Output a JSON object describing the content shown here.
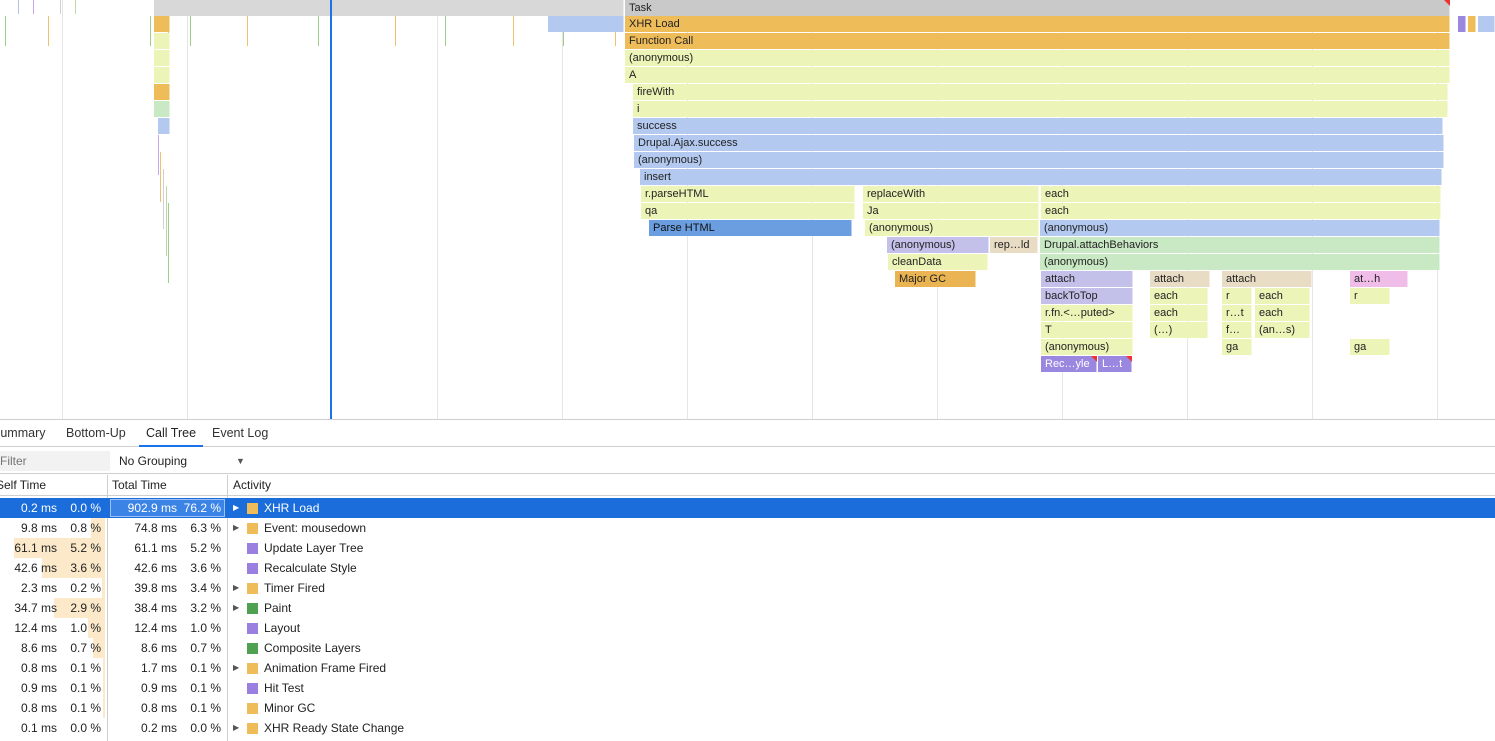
{
  "flame": {
    "labels": {
      "task": "Task",
      "xhr_load": "XHR Load",
      "function_call": "Function Call",
      "anonymous1": "(anonymous)",
      "a": "A",
      "fire_with": "fireWith",
      "i": "i",
      "success": "success",
      "drupal_ajax_success": "Drupal.Ajax.success",
      "anonymous2": "(anonymous)",
      "insert": "insert",
      "r_parse_html": "r.parseHTML",
      "qa": "qa",
      "parse_html": "Parse HTML",
      "replace_with": "replaceWith",
      "ja": "Ja",
      "anonymous3": "(anonymous)",
      "anonymous4": "(anonymous)",
      "rep_ld": "rep…ld",
      "clean_data": "cleanData",
      "major_gc": "Major GC",
      "each1": "each",
      "each2": "each",
      "anonymous5": "(anonymous)",
      "drupal_attach_behaviors": "Drupal.attachBehaviors",
      "anonymous6": "(anonymous)",
      "attach1": "attach",
      "attach2": "attach",
      "attach3": "attach",
      "at_h": "at…h",
      "back_to_top": "backToTop",
      "each3": "each",
      "r1": "r",
      "each4": "each",
      "r2": "r",
      "rfn_computed": "r.fn.<…puted>",
      "each5": "each",
      "r_t": "r…t",
      "each6": "each",
      "t": "T",
      "paren": "(…)",
      "f_dots": "f…",
      "an_s": "(an…s)",
      "anonymous7": "(anonymous)",
      "ga1": "ga",
      "ga2": "ga",
      "rec_yle": "Rec…yle",
      "l_t": "L…t"
    }
  },
  "tabs": {
    "summary": "Summary",
    "bottom_up": "Bottom-Up",
    "call_tree": "Call Tree",
    "event_log": "Event Log"
  },
  "toolbar": {
    "filter_placeholder": "Filter",
    "grouping_value": "No Grouping"
  },
  "columns": {
    "self_time": "Self Time",
    "total_time": "Total Time",
    "activity": "Activity"
  },
  "colors": {
    "scripting": "#efbc5a",
    "rendering": "#9a7fe0",
    "painting": "#4fa14f",
    "selection": "#1a6ddb"
  },
  "rows": [
    {
      "self_ms": "0.2 ms",
      "self_pct": "0.0 %",
      "self_frac": 0.0,
      "total_ms": "902.9 ms",
      "total_pct": "76.2 %",
      "total_frac": 0.762,
      "activity": "XHR Load",
      "category": "scripting",
      "expandable": true,
      "selected": true
    },
    {
      "self_ms": "9.8 ms",
      "self_pct": "0.8 %",
      "self_frac": 0.008,
      "total_ms": "74.8 ms",
      "total_pct": "6.3 %",
      "total_frac": 0.063,
      "activity": "Event: mousedown",
      "category": "scripting",
      "expandable": true,
      "selected": false
    },
    {
      "self_ms": "61.1 ms",
      "self_pct": "5.2 %",
      "self_frac": 0.052,
      "total_ms": "61.1 ms",
      "total_pct": "5.2 %",
      "total_frac": 0.052,
      "activity": "Update Layer Tree",
      "category": "rendering",
      "expandable": false,
      "selected": false
    },
    {
      "self_ms": "42.6 ms",
      "self_pct": "3.6 %",
      "self_frac": 0.036,
      "total_ms": "42.6 ms",
      "total_pct": "3.6 %",
      "total_frac": 0.036,
      "activity": "Recalculate Style",
      "category": "rendering",
      "expandable": false,
      "selected": false
    },
    {
      "self_ms": "2.3 ms",
      "self_pct": "0.2 %",
      "self_frac": 0.002,
      "total_ms": "39.8 ms",
      "total_pct": "3.4 %",
      "total_frac": 0.034,
      "activity": "Timer Fired",
      "category": "scripting",
      "expandable": true,
      "selected": false
    },
    {
      "self_ms": "34.7 ms",
      "self_pct": "2.9 %",
      "self_frac": 0.029,
      "total_ms": "38.4 ms",
      "total_pct": "3.2 %",
      "total_frac": 0.032,
      "activity": "Paint",
      "category": "painting",
      "expandable": true,
      "selected": false
    },
    {
      "self_ms": "12.4 ms",
      "self_pct": "1.0 %",
      "self_frac": 0.01,
      "total_ms": "12.4 ms",
      "total_pct": "1.0 %",
      "total_frac": 0.01,
      "activity": "Layout",
      "category": "rendering",
      "expandable": false,
      "selected": false
    },
    {
      "self_ms": "8.6 ms",
      "self_pct": "0.7 %",
      "self_frac": 0.007,
      "total_ms": "8.6 ms",
      "total_pct": "0.7 %",
      "total_frac": 0.007,
      "activity": "Composite Layers",
      "category": "painting",
      "expandable": false,
      "selected": false
    },
    {
      "self_ms": "0.8 ms",
      "self_pct": "0.1 %",
      "self_frac": 0.001,
      "total_ms": "1.7 ms",
      "total_pct": "0.1 %",
      "total_frac": 0.001,
      "activity": "Animation Frame Fired",
      "category": "scripting",
      "expandable": true,
      "selected": false
    },
    {
      "self_ms": "0.9 ms",
      "self_pct": "0.1 %",
      "self_frac": 0.001,
      "total_ms": "0.9 ms",
      "total_pct": "0.1 %",
      "total_frac": 0.001,
      "activity": "Hit Test",
      "category": "rendering",
      "expandable": false,
      "selected": false
    },
    {
      "self_ms": "0.8 ms",
      "self_pct": "0.1 %",
      "self_frac": 0.001,
      "total_ms": "0.8 ms",
      "total_pct": "0.1 %",
      "total_frac": 0.001,
      "activity": "Minor GC",
      "category": "scripting",
      "expandable": false,
      "selected": false
    },
    {
      "self_ms": "0.1 ms",
      "self_pct": "0.0 %",
      "self_frac": 0.0,
      "total_ms": "0.2 ms",
      "total_pct": "0.0 %",
      "total_frac": 0.0,
      "activity": "XHR Ready State Change",
      "category": "scripting",
      "expandable": true,
      "selected": false
    }
  ]
}
